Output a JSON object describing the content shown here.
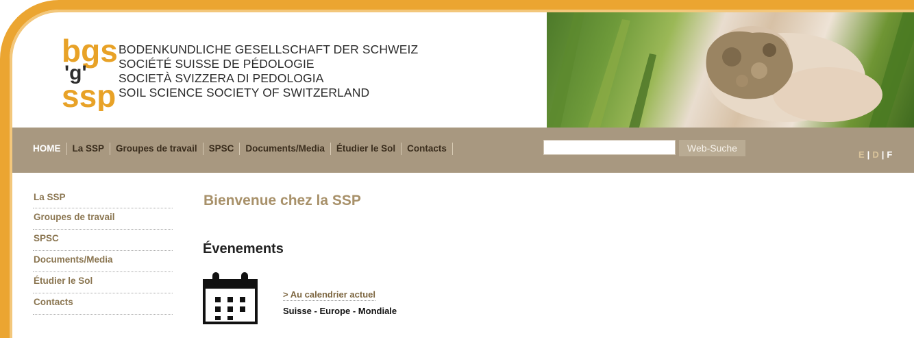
{
  "header": {
    "org_names": [
      "BODENKUNDLICHE GESELLSCHAFT DER SCHWEIZ",
      "SOCIÉTÉ SUISSE DE PÉDOLOGIE",
      "SOCIETÀ SVIZZERA DI PEDOLOGIA",
      "SOIL SCIENCE SOCIETY OF SWITZERLAND"
    ],
    "logo_text": "bgs ssp",
    "photo": "hands-holding-soil"
  },
  "nav": {
    "items": [
      "HOME",
      "La SSP",
      "Groupes de travail",
      "SPSC",
      "Documents/Media",
      "Étudier le Sol",
      "Contacts"
    ],
    "search_value": "",
    "search_button": "Web-Suche",
    "languages": [
      "E",
      "D",
      "F"
    ],
    "language_separator": "|",
    "current_language": "F"
  },
  "sidebar": {
    "items": [
      "La SSP",
      "Groupes de travail",
      "SPSC",
      "Documents/Media",
      "Étudier le Sol",
      "Contacts"
    ]
  },
  "main": {
    "title": "Bienvenue chez la SSP",
    "events_title": "Évenements",
    "calendar_link": "> Au calendrier actuel",
    "scope": "Suisse - Europe - Mondiale"
  },
  "colors": {
    "frame": "#eba531",
    "nav_bg": "#a89880",
    "title_accent": "#a8916a",
    "logo_primary": "#e8a227",
    "logo_dark": "#2c2c2c"
  }
}
